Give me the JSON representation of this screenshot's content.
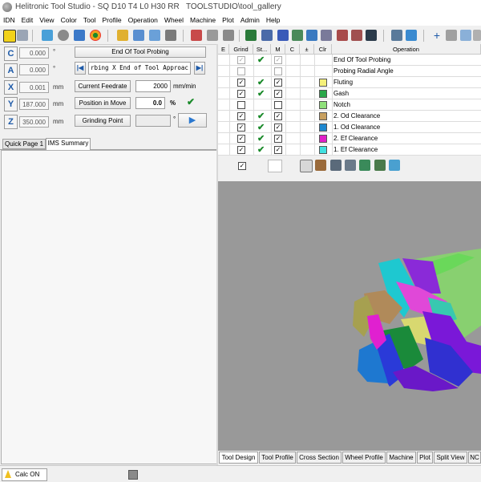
{
  "window": {
    "app_title": "Helitronic Tool Studio - SQ D10 T4 L0 H30 RR",
    "path_title": "TOOLSTUDIO\\tool_gallery"
  },
  "menu": [
    "IDN",
    "Edit",
    "View",
    "Color",
    "Tool",
    "Profile",
    "Operation",
    "Wheel",
    "Machine",
    "Plot",
    "Admin",
    "Help"
  ],
  "axes": [
    {
      "label": "C",
      "value": "0.000",
      "unit": "°"
    },
    {
      "label": "A",
      "value": "0.000",
      "unit": "°"
    },
    {
      "label": "X",
      "value": "0.001",
      "unit": "mm"
    },
    {
      "label": "Y",
      "value": "187.000",
      "unit": "mm"
    },
    {
      "label": "Z",
      "value": "350.000",
      "unit": "mm"
    }
  ],
  "control": {
    "operation_label": "End Of Tool Probing",
    "operation_track": "rbing X End of Tool Approac",
    "feedrate_label": "Current Feedrate",
    "feedrate_value": "2000",
    "feedrate_unit": "mm/min",
    "position_label": "Position in Move",
    "position_value": "0.0",
    "position_unit": "%",
    "grinding_label": "Grinding Point",
    "grinding_unit": "°"
  },
  "left_tabs": [
    "Quick Page 1",
    "IMS Summary"
  ],
  "grid": {
    "headers": [
      "E",
      "Grind",
      "St...",
      "M",
      "C",
      "±",
      "Clr",
      "Operation"
    ],
    "rows": [
      {
        "grind": true,
        "grind_disabled": true,
        "status_tick": true,
        "m": true,
        "m_disabled": true,
        "color": "",
        "name": "End Of Tool Probing"
      },
      {
        "grind": false,
        "grind_disabled": true,
        "status_tick": false,
        "m": false,
        "m_disabled": true,
        "color": "",
        "name": "Probing Radial Angle"
      },
      {
        "grind": true,
        "grind_disabled": false,
        "status_tick": true,
        "m": true,
        "m_disabled": false,
        "color": "#f5f07a",
        "name": "Fluting"
      },
      {
        "grind": true,
        "grind_disabled": false,
        "status_tick": true,
        "m": true,
        "m_disabled": false,
        "color": "#2aa84a",
        "name": "Gash"
      },
      {
        "grind": false,
        "grind_disabled": false,
        "status_tick": false,
        "m": false,
        "m_disabled": false,
        "color": "#8fe07a",
        "name": "Notch"
      },
      {
        "grind": true,
        "grind_disabled": false,
        "status_tick": true,
        "m": true,
        "m_disabled": false,
        "color": "#c8a060",
        "name": "2. Od Clearance"
      },
      {
        "grind": true,
        "grind_disabled": false,
        "status_tick": true,
        "m": true,
        "m_disabled": false,
        "color": "#1e88d0",
        "name": "1. Od Clearance"
      },
      {
        "grind": true,
        "grind_disabled": false,
        "status_tick": true,
        "m": true,
        "m_disabled": false,
        "color": "#e020c8",
        "name": "2. Ef Clearance"
      },
      {
        "grind": true,
        "grind_disabled": false,
        "status_tick": true,
        "m": true,
        "m_disabled": false,
        "color": "#40e0e0",
        "name": "1. Ef Clearance"
      }
    ]
  },
  "bottom_tabs": [
    "Tool Design",
    "Tool Profile",
    "Cross Section",
    "Wheel Profile",
    "Machine",
    "Plot",
    "Split View",
    "NC"
  ],
  "status": {
    "calc_label": "Calc ON"
  },
  "colors": {
    "viewport_bg": "#999999",
    "accent_blue": "#1e5aa8",
    "tick_green": "#1a8a2a"
  }
}
